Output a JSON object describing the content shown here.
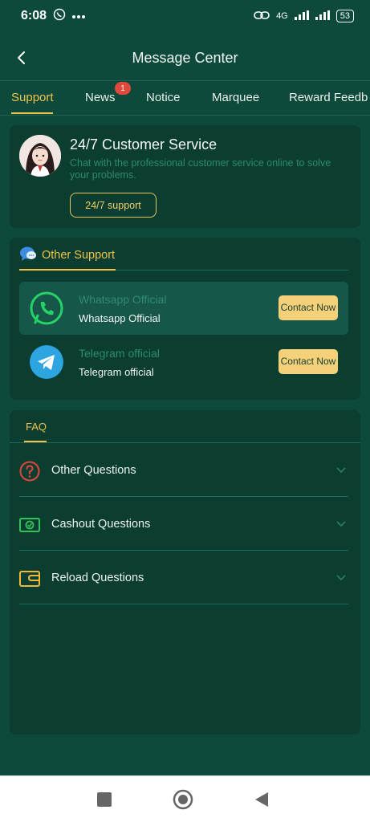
{
  "status": {
    "time": "6:08",
    "network": "4G",
    "battery": "53"
  },
  "header": {
    "title": "Message Center"
  },
  "tabs": [
    {
      "label": "Support",
      "active": true
    },
    {
      "label": "News",
      "badge": "1"
    },
    {
      "label": "Notice"
    },
    {
      "label": "Marquee"
    },
    {
      "label": "Reward Feedb"
    }
  ],
  "customer_service": {
    "title": "24/7 Customer Service",
    "description": "Chat with the professional customer service online to solve your problems.",
    "button": "24/7 support"
  },
  "other_support": {
    "title": "Other Support",
    "contacts": [
      {
        "title": "Whatsapp Official",
        "subtitle": "Whatsapp Official",
        "button": "Contact Now",
        "icon": "whatsapp-icon",
        "color": "#25d366"
      },
      {
        "title": "Telegram official",
        "subtitle": "Telegram official",
        "button": "Contact Now",
        "icon": "telegram-icon",
        "color": "#2ca5e0"
      }
    ]
  },
  "faq": {
    "tab": "FAQ",
    "items": [
      {
        "label": "Other Questions",
        "icon": "question-icon",
        "color": "#e0483b"
      },
      {
        "label": "Cashout Questions",
        "icon": "cash-icon",
        "color": "#33c15a"
      },
      {
        "label": "Reload Questions",
        "icon": "wallet-icon",
        "color": "#f0b83b"
      }
    ]
  },
  "colors": {
    "background": "#0d4a3b",
    "card": "#0b3d31",
    "accent": "#f0c24b"
  }
}
